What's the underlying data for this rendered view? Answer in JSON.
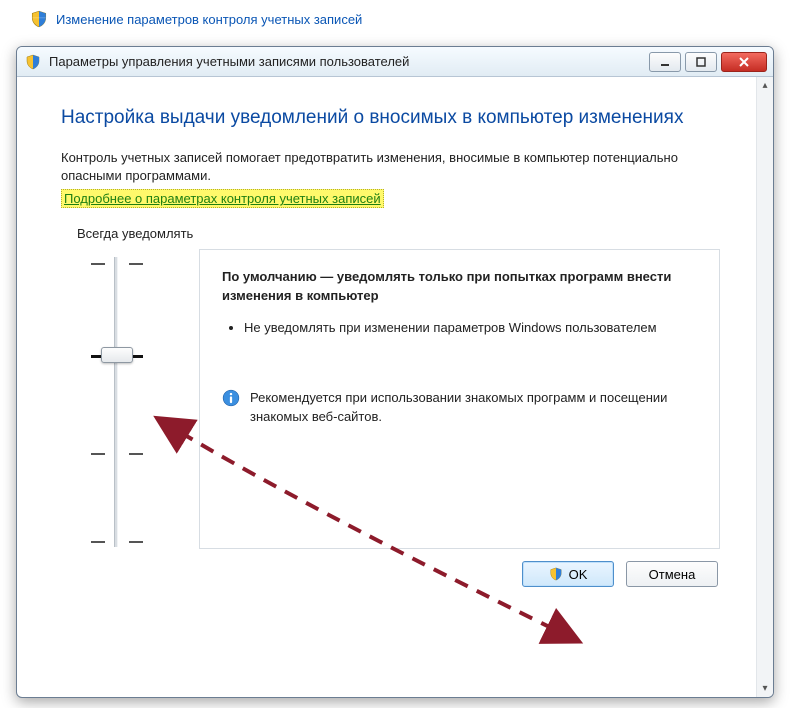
{
  "outer": {
    "link_text": "Изменение параметров контроля учетных записей"
  },
  "window": {
    "title": "Параметры управления учетными записями пользователей"
  },
  "content": {
    "heading": "Настройка выдачи уведомлений о вносимых в компьютер изменениях",
    "intro": "Контроль учетных записей помогает предотвратить изменения, вносимые в компьютер потенциально опасными программами.",
    "help_link": "Подробнее о параметрах контроля учетных записей",
    "top_caption": "Всегда уведомлять",
    "desc_title": "По умолчанию — уведомлять только при попытках программ внести изменения в компьютер",
    "bullet1": "Не уведомлять при изменении параметров Windows пользователем",
    "info_text": "Рекомендуется при использовании знакомых программ и посещении знакомых веб-сайтов."
  },
  "buttons": {
    "ok": "OK",
    "cancel": "Отмена"
  }
}
